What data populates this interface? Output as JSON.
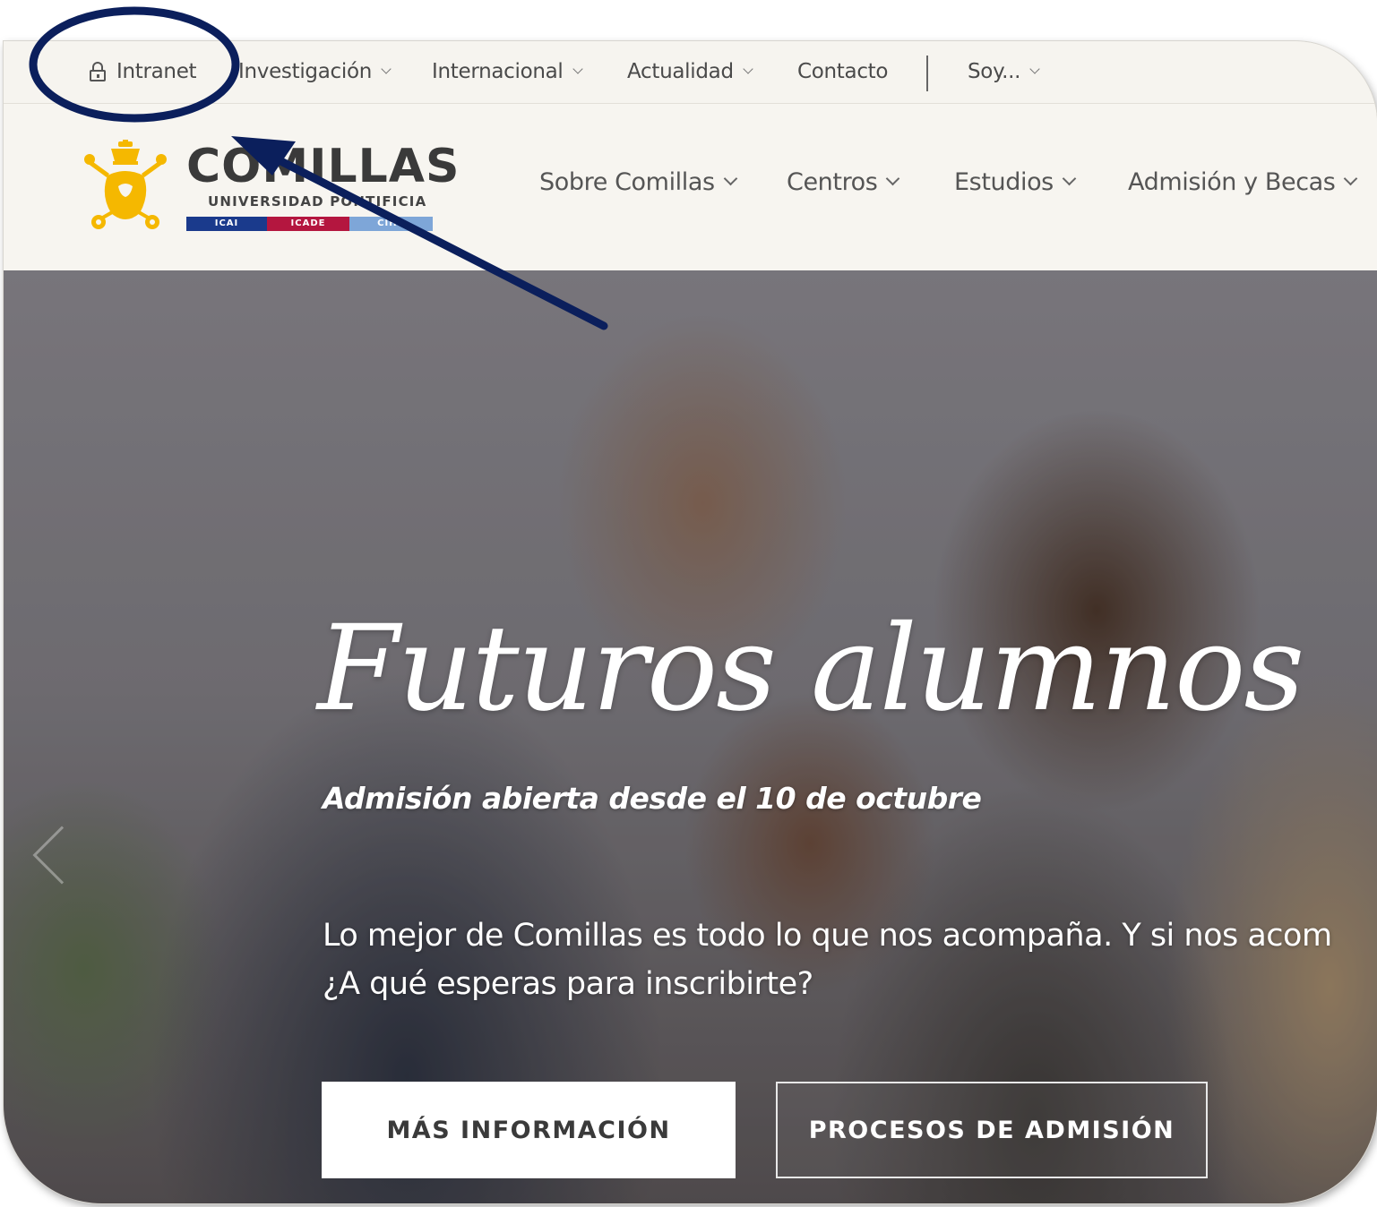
{
  "topbar": {
    "intranet": "Intranet",
    "investigacion": "Investigación",
    "internacional": "Internacional",
    "actualidad": "Actualidad",
    "contacto": "Contacto",
    "soy": "Soy..."
  },
  "logo": {
    "name": "COMILLAS",
    "subtitle": "UNIVERSIDAD PONTIFICIA",
    "bars": [
      "ICAI",
      "ICADE",
      "CIHS"
    ]
  },
  "mainnav": {
    "items": [
      "Sobre Comillas",
      "Centros",
      "Estudios",
      "Admisión y Becas"
    ]
  },
  "hero": {
    "title": "Futuros alumnos",
    "subtitle": "Admisión abierta desde el 10 de octubre",
    "body_line1": "Lo mejor de Comillas es todo lo que nos acompaña. Y si nos acom",
    "body_line2": "¿A qué esperas para inscribirte?",
    "primary_button": "MÁS INFORMACIÓN",
    "secondary_button": "PROCESOS DE ADMISIÓN"
  },
  "colors": {
    "annotation": "#0b1f5c",
    "logo_gold": "#f5b800",
    "bar_icai": "#1a3a8c",
    "bar_icade": "#b4163f",
    "bar_cihs": "#7ea6d8"
  }
}
